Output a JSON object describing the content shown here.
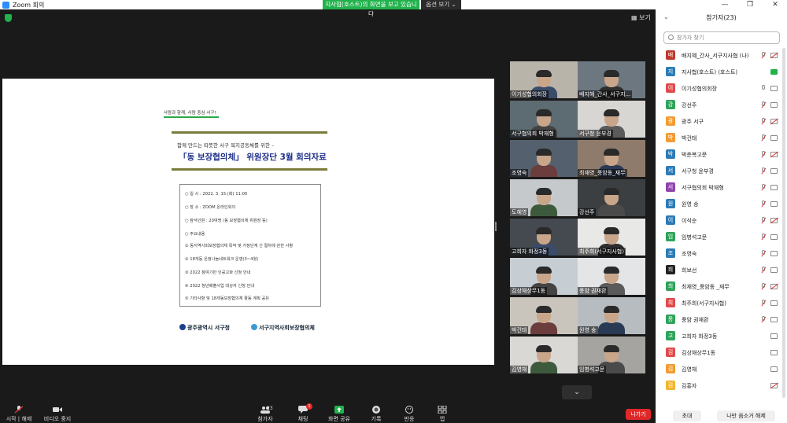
{
  "window": {
    "title": "Zoom 회의",
    "controls": [
      "—",
      "❐",
      "✕"
    ]
  },
  "banner": {
    "sharing": "지사협(호스트)의 화면을 보고 있습니다",
    "view_options": "옵션 보기 ⌄"
  },
  "top_right": {
    "view": "보기"
  },
  "slide": {
    "tag": "사람과 함께, 사람 중심 서구!",
    "subtitle": "함께 만드는 따뜻한 서구 복지공동체를 위한 –",
    "title": "「동 보장협의체」 위원장단 3월 회의자료",
    "rows": [
      "○  일      시 : 2022. 3. 15.(화) 11:00",
      "○  장      소 : ZOOM 온라인회의",
      "○  참석인원 : 20여명 (동 보장협의체 위원장 등)",
      "○  주요내용",
      "  ① 동지역사회보장협의체 목적 및 가정단계 신 절차에 관한 사항",
      "  ② 18개동 온정나눔네트워크 운영(3~4월)",
      "  ③ 2022 참여기반 인공고화 신청 안내",
      "  ④ 2022 청년배출사업 대상자 신청 안내",
      "  ⑤ 기타사항 및 18개동보장협의체 활동 계획 공유"
    ],
    "logo_left": "광주광역시 서구청",
    "logo_right": "서구지역사회보장협의체"
  },
  "tiles": [
    {
      "name": "이기성협의회장",
      "color": "#b9b4aa"
    },
    {
      "name": "배지혜_간사_서구지...",
      "color": "#6d7780"
    },
    {
      "name": "서구협의회 박재형",
      "color": "#5d6b72"
    },
    {
      "name": "서구청 윤부경",
      "color": "#d8d6d2"
    },
    {
      "name": "조영숙",
      "color": "#55606e"
    },
    {
      "name": "최재영_풍암동_재무",
      "color": "#8f7b6b"
    },
    {
      "name": "도혜영",
      "color": "#c6c9cc"
    },
    {
      "name": "강선주",
      "color": "#3b3f42"
    },
    {
      "name": "고희자 화정3동",
      "color": "#444a4f"
    },
    {
      "name": "최주희(서구지사협)",
      "color": "#e8e8e6"
    },
    {
      "name": "김상채상무1동",
      "color": "#c7ced3"
    },
    {
      "name": "풍암 권재환",
      "color": "#e3e5e7"
    },
    {
      "name": "박건태",
      "color": "#c9c5bd"
    },
    {
      "name": "원영 숭",
      "color": "#b7bcc0"
    },
    {
      "name": "김영채",
      "color": "#dad8d4"
    },
    {
      "name": "임병석고문",
      "color": "#a6a4a0"
    }
  ],
  "toolbar": {
    "audio": "시작 | 해제",
    "video": "비디오 중지",
    "participants": "참가자",
    "participants_count": "23",
    "chat": "채팅",
    "chat_badge": "1",
    "share": "화면 공유",
    "record": "기록",
    "reactions": "반응",
    "apps": "앱",
    "leave": "나가기"
  },
  "panel": {
    "title": "참가자(23)",
    "search_placeholder": "참가자 찾기",
    "participants": [
      {
        "initial": "배",
        "name": "배지혜_간사_서구지사협 (나)",
        "color": "#c0392b",
        "mic": "muted",
        "cam": "off"
      },
      {
        "initial": "지",
        "name": "지사협(호스트) (호스트)",
        "color": "#2c7bb6",
        "mic": "none",
        "cam": "on"
      },
      {
        "initial": "이",
        "name": "이기성협의회장",
        "color": "#e04b4b",
        "mic": "on",
        "cam": "plain"
      },
      {
        "initial": "강",
        "name": "강선주",
        "color": "#2fa35a",
        "mic": "muted",
        "cam": "plain"
      },
      {
        "initial": "광",
        "name": "광주 서구",
        "color": "#f39c33",
        "mic": "muted",
        "cam": "off"
      },
      {
        "initial": "박",
        "name": "박건태",
        "color": "#f39c33",
        "mic": "muted",
        "cam": "plain"
      },
      {
        "initial": "박",
        "name": "박춘복고문",
        "color": "#2c7bb6",
        "mic": "muted",
        "cam": "off"
      },
      {
        "initial": "서",
        "name": "서구청 윤부경",
        "color": "#2c7bb6",
        "mic": "muted",
        "cam": "plain"
      },
      {
        "initial": "서",
        "name": "서구협의회 박재형",
        "color": "#8e44ad",
        "mic": "muted",
        "cam": "plain"
      },
      {
        "initial": "원",
        "name": "원영 숭",
        "color": "#2c7bb6",
        "mic": "muted",
        "cam": "plain"
      },
      {
        "initial": "이",
        "name": "이석순",
        "color": "#2c7bb6",
        "mic": "muted",
        "cam": "off"
      },
      {
        "initial": "임",
        "name": "임병석고문",
        "color": "#2fa35a",
        "mic": "muted",
        "cam": "plain"
      },
      {
        "initial": "조",
        "name": "조영숙",
        "color": "#2c7bb6",
        "mic": "muted",
        "cam": "plain"
      },
      {
        "initial": "희",
        "name": "희보선",
        "color": "#222222",
        "mic": "muted",
        "cam": "plain"
      },
      {
        "initial": "최",
        "name": "최재영_풍암동 _재무",
        "color": "#2fa35a",
        "mic": "muted",
        "cam": "off"
      },
      {
        "initial": "최",
        "name": "최주희(서구지사협)",
        "color": "#e04b4b",
        "mic": "muted",
        "cam": "plain"
      },
      {
        "initial": "풍",
        "name": "풍암 권재환",
        "color": "#2fa35a",
        "mic": "muted",
        "cam": "plain"
      },
      {
        "initial": "고",
        "name": "고희자 화정3동",
        "color": "#2fa35a",
        "mic": "none",
        "cam": "plain"
      },
      {
        "initial": "김",
        "name": "김상채상무1동",
        "color": "#e04b4b",
        "mic": "none",
        "cam": "plain"
      },
      {
        "initial": "김",
        "name": "김영채",
        "color": "#f39c33",
        "mic": "none",
        "cam": "plain"
      },
      {
        "initial": "김",
        "name": "김홍자",
        "color": "#f3b52f",
        "mic": "none",
        "cam": "off"
      }
    ],
    "invite": "초대",
    "unmute_me": "나만 음소거 해제"
  }
}
